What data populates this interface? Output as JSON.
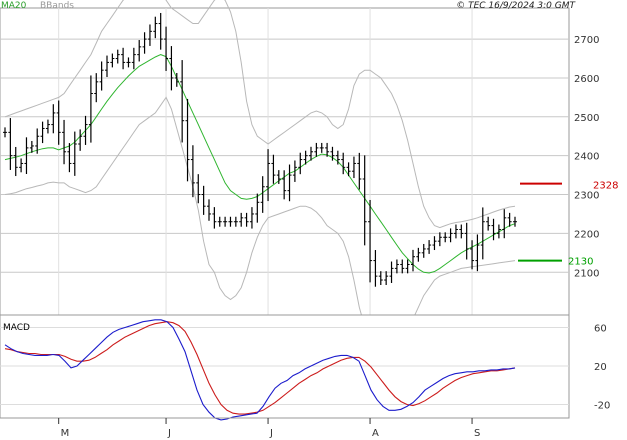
{
  "header": {
    "legend_ma": "MA20",
    "legend_bb": "BBands",
    "credit": "© TEC 16/9/2024 3:0 GMT"
  },
  "colors": {
    "price_bars": "#000000",
    "ma20": "#2fb52f",
    "bbands": "#b8b8b8",
    "grid": "#c8c8c8",
    "macd": "#1c1ccc",
    "signal": "#cc1c1c",
    "resistance": "#cc0000",
    "support": "#00a000"
  },
  "chart_data": [
    {
      "type": "line",
      "title": "",
      "chart_kind": "OHLC bars with 20-period moving average and Bollinger Bands",
      "y_axis_position": "right",
      "ylim": [
        1990,
        2780
      ],
      "y_ticks": [
        "2700",
        "2600",
        "2500",
        "2400",
        "2300",
        "2200",
        "2100"
      ],
      "y_tick_values": [
        2700,
        2600,
        2500,
        2400,
        2300,
        2200,
        2100
      ],
      "x_ticks": [
        "M",
        "J",
        "J",
        "A",
        "S"
      ],
      "x_tick_index": [
        10,
        30,
        49,
        68,
        87
      ],
      "x_count": 96,
      "levels": [
        {
          "name": "2328",
          "value": 2328,
          "color": "resistance"
        },
        {
          "name": "2130",
          "value": 2130,
          "color": "support"
        }
      ],
      "series": [
        {
          "name": "price",
          "values": [
            2460,
            2400,
            2370,
            2380,
            2420,
            2425,
            2450,
            2470,
            2480,
            2510,
            2460,
            2410,
            2380,
            2430,
            2450,
            2480,
            2560,
            2590,
            2620,
            2640,
            2650,
            2660,
            2640,
            2640,
            2660,
            2680,
            2700,
            2720,
            2740,
            2700,
            2650,
            2600,
            2590,
            2490,
            2390,
            2330,
            2300,
            2270,
            2250,
            2230,
            2230,
            2230,
            2230,
            2230,
            2240,
            2230,
            2250,
            2280,
            2320,
            2380,
            2350,
            2340,
            2310,
            2350,
            2370,
            2390,
            2400,
            2410,
            2420,
            2420,
            2410,
            2400,
            2390,
            2370,
            2360,
            2380,
            2340,
            2230,
            2130,
            2090,
            2080,
            2090,
            2110,
            2120,
            2110,
            2120,
            2140,
            2150,
            2160,
            2170,
            2180,
            2190,
            2190,
            2200,
            2210,
            2200,
            2160,
            2130,
            2170,
            2230,
            2220,
            2200,
            2210,
            2240,
            2230,
            2230
          ]
        },
        {
          "name": "MA20",
          "values": [
            2390,
            2393,
            2396,
            2400,
            2405,
            2410,
            2414,
            2418,
            2420,
            2420,
            2415,
            2420,
            2425,
            2435,
            2450,
            2465,
            2480,
            2500,
            2520,
            2540,
            2558,
            2575,
            2590,
            2605,
            2618,
            2630,
            2638,
            2646,
            2654,
            2660,
            2655,
            2630,
            2600,
            2570,
            2540,
            2510,
            2480,
            2450,
            2420,
            2390,
            2360,
            2330,
            2310,
            2300,
            2290,
            2288,
            2290,
            2295,
            2305,
            2315,
            2325,
            2335,
            2345,
            2355,
            2360,
            2370,
            2380,
            2390,
            2398,
            2404,
            2402,
            2395,
            2385,
            2370,
            2350,
            2330,
            2310,
            2290,
            2270,
            2250,
            2230,
            2210,
            2190,
            2170,
            2150,
            2135,
            2120,
            2108,
            2100,
            2098,
            2102,
            2110,
            2120,
            2130,
            2140,
            2150,
            2158,
            2165,
            2172,
            2180,
            2188,
            2196,
            2204,
            2212,
            2220,
            2225
          ]
        },
        {
          "name": "BB upper",
          "values": [
            2500,
            2505,
            2510,
            2515,
            2520,
            2525,
            2530,
            2535,
            2540,
            2545,
            2550,
            2560,
            2580,
            2600,
            2620,
            2640,
            2660,
            2690,
            2720,
            2740,
            2760,
            2780,
            2800,
            2810,
            2820,
            2830,
            2840,
            2850,
            2840,
            2820,
            2800,
            2780,
            2770,
            2760,
            2750,
            2740,
            2740,
            2760,
            2780,
            2800,
            2810,
            2800,
            2770,
            2720,
            2640,
            2540,
            2480,
            2450,
            2440,
            2430,
            2440,
            2450,
            2460,
            2470,
            2480,
            2490,
            2500,
            2510,
            2515,
            2510,
            2500,
            2480,
            2470,
            2480,
            2520,
            2580,
            2610,
            2620,
            2620,
            2610,
            2600,
            2580,
            2560,
            2530,
            2490,
            2440,
            2380,
            2320,
            2270,
            2240,
            2220,
            2215,
            2220,
            2225,
            2228,
            2230,
            2233,
            2236,
            2240,
            2245,
            2250,
            2255,
            2260,
            2264,
            2268,
            2270
          ]
        },
        {
          "name": "BB lower",
          "values": [
            2300,
            2302,
            2305,
            2310,
            2315,
            2318,
            2322,
            2325,
            2330,
            2332,
            2330,
            2330,
            2320,
            2315,
            2310,
            2305,
            2310,
            2320,
            2340,
            2360,
            2380,
            2400,
            2420,
            2440,
            2460,
            2480,
            2490,
            2500,
            2510,
            2530,
            2550,
            2520,
            2470,
            2420,
            2370,
            2320,
            2260,
            2180,
            2120,
            2100,
            2060,
            2040,
            2030,
            2040,
            2060,
            2100,
            2150,
            2190,
            2220,
            2240,
            2245,
            2250,
            2255,
            2260,
            2265,
            2270,
            2270,
            2265,
            2255,
            2240,
            2220,
            2210,
            2200,
            2180,
            2140,
            2080,
            2010,
            1960,
            1910,
            1890,
            1880,
            1880,
            1885,
            1900,
            1920,
            1950,
            1980,
            2010,
            2040,
            2060,
            2080,
            2090,
            2095,
            2100,
            2105,
            2110,
            2112,
            2114,
            2116,
            2118,
            2120,
            2122,
            2124,
            2126,
            2128,
            2130
          ]
        }
      ]
    },
    {
      "type": "line",
      "title": "MACD",
      "y_axis_position": "right",
      "ylim": [
        -34,
        73
      ],
      "y_ticks": [
        "60",
        "20",
        "-20"
      ],
      "y_tick_values": [
        60,
        20,
        -20
      ],
      "series": [
        {
          "name": "MACD",
          "values": [
            42,
            38,
            35,
            33,
            32,
            31,
            31,
            31,
            32,
            31,
            25,
            18,
            20,
            26,
            32,
            38,
            44,
            50,
            55,
            58,
            60,
            62,
            64,
            66,
            67,
            68,
            68,
            66,
            60,
            48,
            35,
            15,
            -5,
            -20,
            -28,
            -34,
            -36,
            -35,
            -33,
            -32,
            -31,
            -30,
            -29,
            -22,
            -12,
            -3,
            2,
            5,
            10,
            13,
            17,
            20,
            23,
            26,
            28,
            30,
            31,
            31,
            29,
            25,
            10,
            -5,
            -15,
            -22,
            -26,
            -26,
            -25,
            -22,
            -18,
            -12,
            -5,
            -1,
            3,
            7,
            10,
            12,
            13,
            14,
            14,
            15,
            15,
            16,
            16,
            17,
            17,
            18
          ]
        },
        {
          "name": "Signal",
          "values": [
            38,
            37,
            35,
            34,
            33,
            33,
            32,
            32,
            32,
            32,
            30,
            27,
            25,
            25,
            26,
            29,
            33,
            37,
            42,
            46,
            50,
            53,
            56,
            59,
            62,
            64,
            65,
            66,
            65,
            62,
            56,
            45,
            32,
            17,
            2,
            -10,
            -20,
            -26,
            -29,
            -30,
            -30,
            -29,
            -28,
            -26,
            -22,
            -18,
            -13,
            -8,
            -3,
            2,
            6,
            10,
            13,
            17,
            20,
            23,
            26,
            28,
            29,
            29,
            25,
            19,
            11,
            3,
            -5,
            -12,
            -17,
            -20,
            -21,
            -19,
            -16,
            -12,
            -8,
            -3,
            1,
            5,
            8,
            10,
            12,
            13,
            14,
            15,
            15,
            16,
            17,
            18
          ]
        }
      ]
    }
  ]
}
